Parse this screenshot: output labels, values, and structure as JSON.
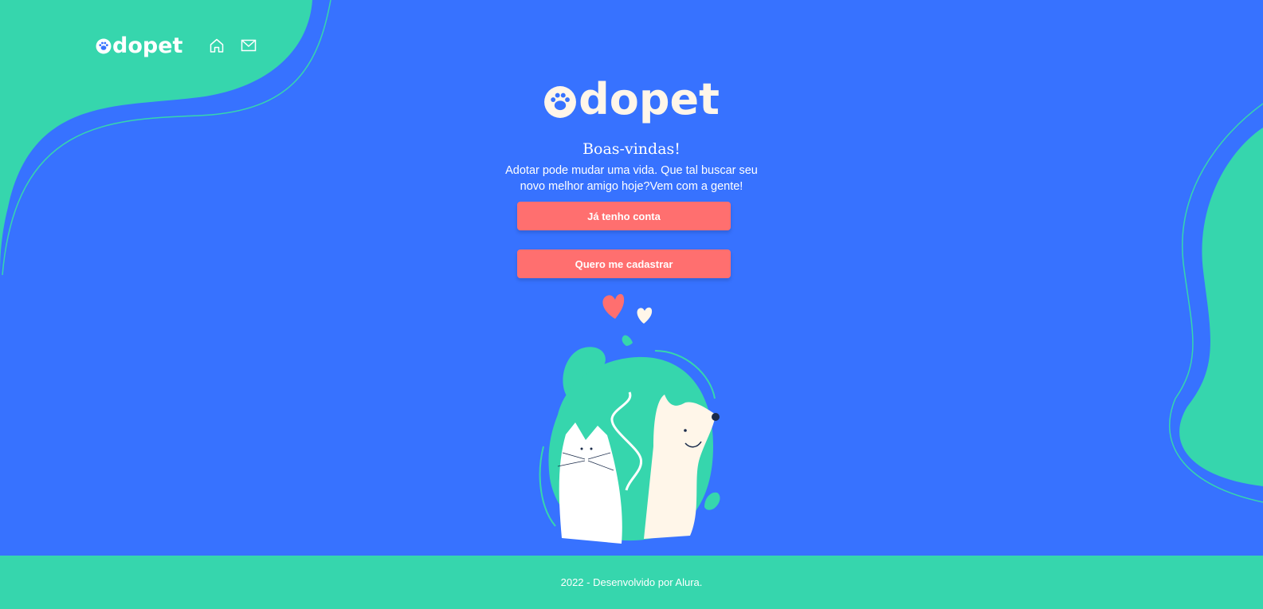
{
  "header": {
    "logo_text": "dopet",
    "nav": [
      {
        "icon": "home-icon"
      },
      {
        "icon": "mail-icon"
      }
    ]
  },
  "hero": {
    "logo_text": "dopet",
    "welcome": "Boas-vindas!",
    "subtitle_line1": "Adotar pode mudar uma vida. Que tal buscar seu",
    "subtitle_line2": "novo melhor amigo hoje?Vem com a gente!"
  },
  "buttons": {
    "login_label": "Já tenho conta",
    "signup_label": "Quero me cadastrar"
  },
  "footer": {
    "text": "2022 - Desenvolvido por Alura."
  },
  "colors": {
    "background": "#3772FF",
    "accent_green": "#36D6AD",
    "button": "#FF6F6F",
    "cream": "#FFF6E9"
  }
}
